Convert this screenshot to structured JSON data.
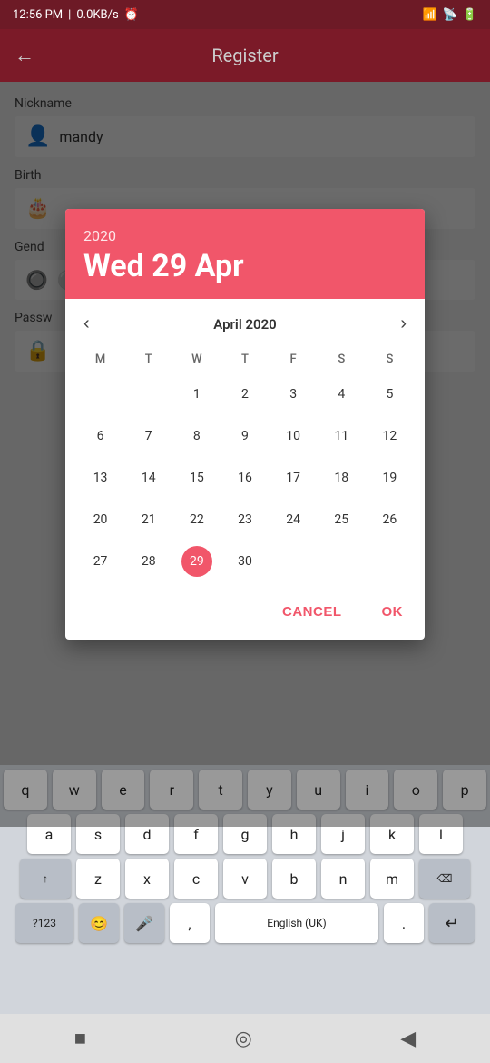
{
  "statusBar": {
    "time": "12:56 PM",
    "network": "0.0KB/s",
    "icon": "⏰"
  },
  "appBar": {
    "title": "Register",
    "backIcon": "←"
  },
  "form": {
    "nicknameLabel": "Nickname",
    "nicknameValue": "mandy",
    "birthLabel": "Birth",
    "genderLabel": "Gend",
    "passwordLabel": "Passw"
  },
  "calendar": {
    "year": "2020",
    "dateLabel": "Wed 29 Apr",
    "monthLabel": "April 2020",
    "prevIcon": "‹",
    "nextIcon": "›",
    "dayHeaders": [
      "M",
      "T",
      "W",
      "T",
      "F",
      "S",
      "S"
    ],
    "weeks": [
      [
        "",
        "",
        "1",
        "2",
        "3",
        "4",
        "5"
      ],
      [
        "6",
        "7",
        "8",
        "9",
        "10",
        "11",
        "12"
      ],
      [
        "13",
        "14",
        "15",
        "16",
        "17",
        "18",
        "19"
      ],
      [
        "20",
        "21",
        "22",
        "23",
        "24",
        "25",
        "26"
      ],
      [
        "27",
        "28",
        "29",
        "30",
        "",
        "",
        ""
      ]
    ],
    "selectedDay": "29",
    "cancelLabel": "CANCEL",
    "okLabel": "OK"
  },
  "keyboard": {
    "row1": [
      "q",
      "w",
      "e",
      "r",
      "t",
      "y",
      "u",
      "i",
      "o",
      "p"
    ],
    "row2": [
      "a",
      "s",
      "d",
      "f",
      "g",
      "h",
      "j",
      "k",
      "l"
    ],
    "row3": [
      "↑",
      "z",
      "x",
      "c",
      "v",
      "b",
      "n",
      "m",
      "⌫"
    ],
    "row4": [
      "?123",
      "😊",
      "mic",
      ",",
      "",
      "English (UK)",
      "",
      ".",
      "|←"
    ]
  },
  "navBar": {
    "stopIcon": "■",
    "homeIcon": "◎",
    "backIcon": "◀"
  }
}
